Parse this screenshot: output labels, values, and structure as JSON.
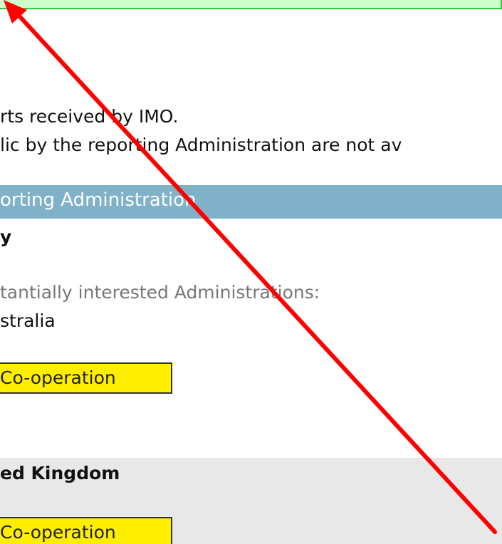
{
  "notes": {
    "line1": "rts received by IMO.",
    "line2": "lic by the reporting Administration are not av"
  },
  "section": {
    "header": "orting Administration"
  },
  "entries": [
    {
      "country": "y",
      "sub_label": "tantially interested Administrations:",
      "sub_value": "stralia",
      "button_label": "Co-operation"
    },
    {
      "country": "ed Kingdom",
      "button_label": "Co-operation"
    }
  ],
  "colors": {
    "banner": "#ccffcc",
    "section_header": "#7fb2c9",
    "button": "#ffee00",
    "entry_alt_bg": "#e8e8e8",
    "annotation_arrow": "#ff0000"
  }
}
